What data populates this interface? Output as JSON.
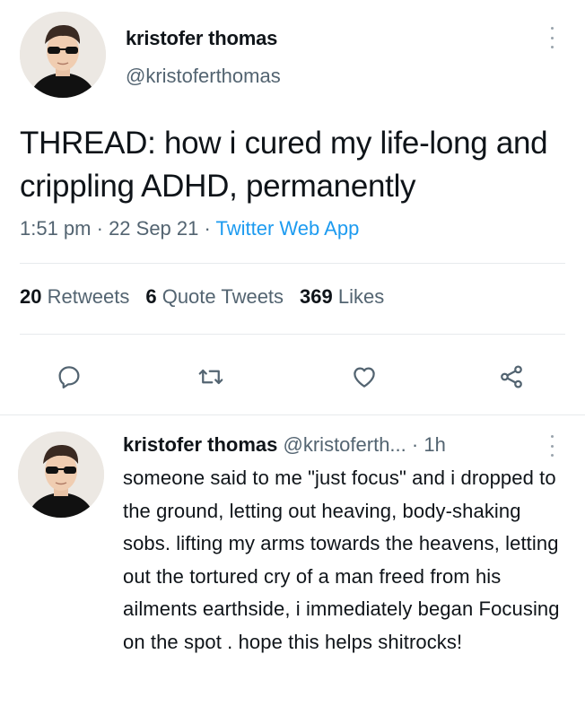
{
  "tweet": {
    "author_name": "kristofer thomas",
    "author_handle": "@kristoferthomas",
    "text": "THREAD: how i cured my life-long and crippling ADHD, permanently",
    "time": "1:51 pm",
    "separator1": " · ",
    "date": "22 Sep 21",
    "separator2": " · ",
    "source": "Twitter Web App",
    "stats": {
      "retweets_count": "20",
      "retweets_label": "Retweets",
      "quotes_count": "6",
      "quotes_label": "Quote Tweets",
      "likes_count": "369",
      "likes_label": "Likes"
    },
    "action_icons": [
      "reply-icon",
      "retweet-icon",
      "like-icon",
      "share-icon"
    ]
  },
  "reply": {
    "author_name": "kristofer thomas",
    "author_handle": "@kristoferth...",
    "separator": " · ",
    "time": "1h",
    "text": "someone said to me \"just focus\" and i dropped to the ground, letting out heaving, body-shaking sobs. lifting my arms towards the heavens, letting out the tortured cry of a man freed from his ailments earthside, i immediately began Focusing on the spot . hope this helps shitrocks!"
  },
  "colors": {
    "text": "#0f1419",
    "secondary": "#536471",
    "link": "#1d9bf0",
    "divider": "#e7eaed"
  }
}
